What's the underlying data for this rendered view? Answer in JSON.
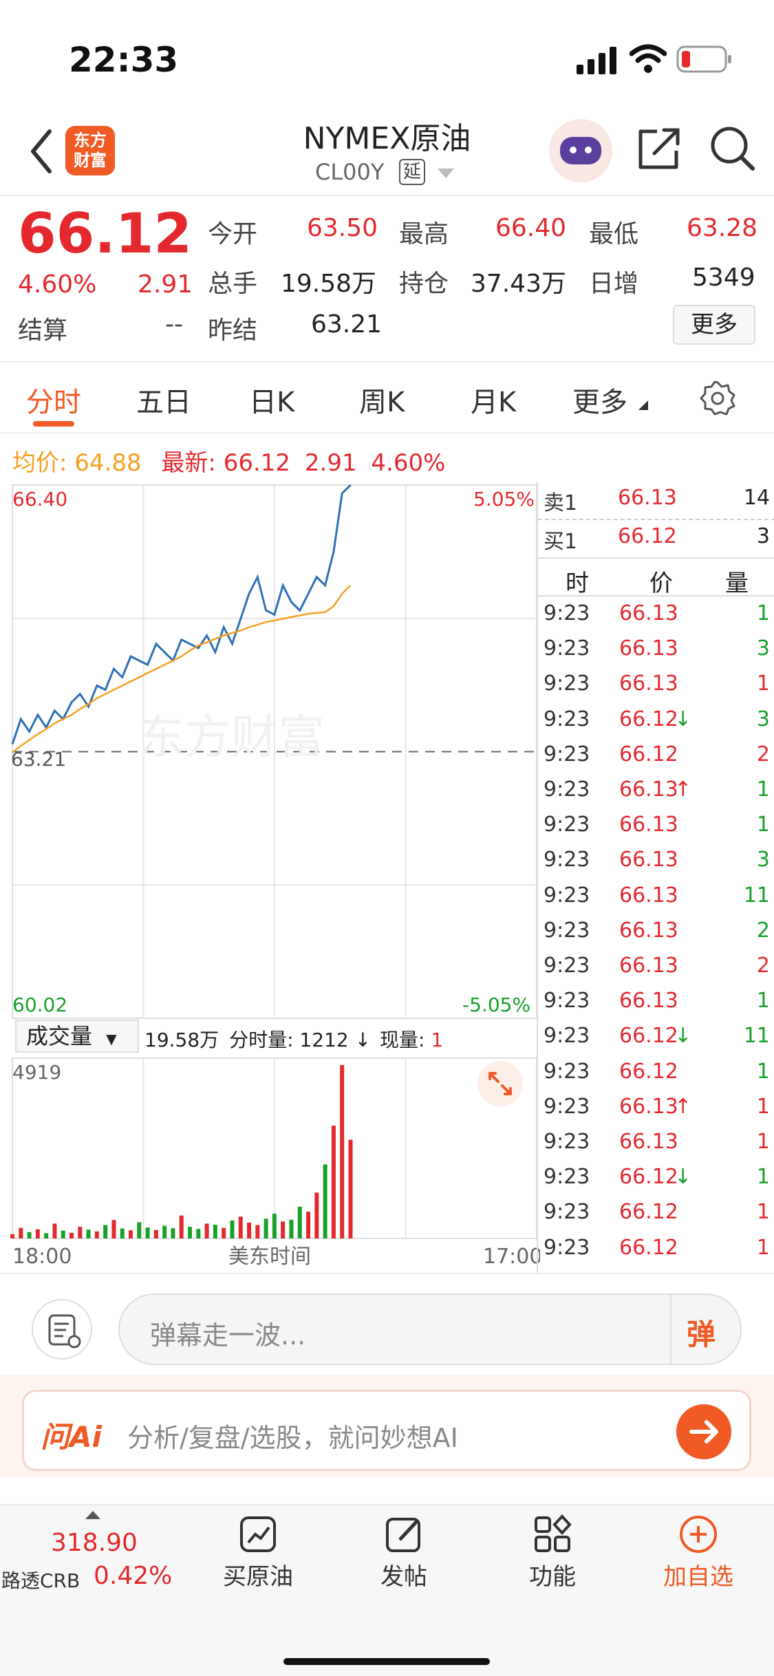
{
  "status": {
    "time": "22:33"
  },
  "header": {
    "logo_text": "东方\n财富",
    "title": "NYMEX原油",
    "code": "CL00Y",
    "delay_badge": "延"
  },
  "quote": {
    "price": "66.12",
    "change_pct": "4.60%",
    "change": "2.91",
    "settle_label": "结算",
    "settle_value": "--",
    "prev_settle_label": "昨结",
    "prev_settle_value": "63.21",
    "open_label": "今开",
    "open_value": "63.50",
    "high_label": "最高",
    "high_value": "66.40",
    "low_label": "最低",
    "low_value": "63.28",
    "volume_label": "总手",
    "volume_value": "19.58万",
    "oi_label": "持仓",
    "oi_value": "37.43万",
    "daily_inc_label": "日增",
    "daily_inc_value": "5349",
    "more_button": "更多"
  },
  "tabs": [
    "分时",
    "五日",
    "日K",
    "周K",
    "月K",
    "更多"
  ],
  "active_tab": 0,
  "avg_line": {
    "avg_label": "均价:",
    "avg_value": "64.88",
    "latest_label": "最新:",
    "latest_value": "66.12",
    "latest_change": "2.91",
    "latest_pct": "4.60%"
  },
  "chart_data": {
    "type": "line",
    "ylim": [
      60.02,
      66.4
    ],
    "y_top_label": "66.40",
    "y_bottom_label": "60.02",
    "y_mid_label": "63.21",
    "pct_top_label": "5.05%",
    "pct_bottom_label": "-5.05%",
    "x_labels": [
      "18:00",
      "美东时间",
      "17:00"
    ],
    "series": [
      {
        "values": [
          63.3,
          63.6,
          63.45,
          63.65,
          63.5,
          63.7,
          63.6,
          63.8,
          63.9,
          63.75,
          64.0,
          63.95,
          64.2,
          64.1,
          64.35,
          64.3,
          64.25,
          64.5,
          64.4,
          64.3,
          64.55,
          64.5,
          64.45,
          64.6,
          64.4,
          64.7,
          64.5,
          64.8,
          65.1,
          65.3,
          64.9,
          64.85,
          65.2,
          65.0,
          64.9,
          65.1,
          65.3,
          65.2,
          65.6,
          66.3,
          66.4
        ],
        "color": "#2d6fb9"
      },
      {
        "values": [
          63.2,
          63.28,
          63.35,
          63.42,
          63.48,
          63.55,
          63.6,
          63.65,
          63.72,
          63.78,
          63.85,
          63.9,
          63.95,
          64.0,
          64.05,
          64.1,
          64.15,
          64.2,
          64.25,
          64.3,
          64.35,
          64.42,
          64.48,
          64.52,
          64.56,
          64.6,
          64.63,
          64.66,
          64.7,
          64.73,
          64.76,
          64.78,
          64.8,
          64.82,
          64.84,
          64.86,
          64.87,
          64.88,
          64.95,
          65.1,
          65.2
        ],
        "color": "#f5a020"
      }
    ],
    "volume_max_label": "4919",
    "volume_values": [
      120,
      300,
      180,
      260,
      150,
      420,
      220,
      160,
      330,
      250,
      200,
      380,
      520,
      280,
      230,
      460,
      310,
      240,
      360,
      290,
      650,
      330,
      270,
      420,
      390,
      300,
      510,
      620,
      450,
      380,
      560,
      700,
      480,
      530,
      900,
      760,
      1300,
      2100,
      3200,
      4919,
      2800
    ]
  },
  "volume_bar": {
    "dropdown": "成交量",
    "total": "19.58万",
    "period_label": "分时量:",
    "period_value": "1212",
    "arrow": "↓",
    "now_label": "现量:",
    "now_value": "1"
  },
  "orderbook": {
    "sell_label": "卖1",
    "sell_price": "66.13",
    "sell_qty": "14",
    "buy_label": "买1",
    "buy_price": "66.12",
    "buy_qty": "3"
  },
  "trade_header": {
    "time": "时",
    "price": "价",
    "qty": "量"
  },
  "trades": [
    {
      "t": "9:23",
      "p": "66.13",
      "a": "",
      "q": "1",
      "qc": "green"
    },
    {
      "t": "9:23",
      "p": "66.13",
      "a": "",
      "q": "3",
      "qc": "green"
    },
    {
      "t": "9:23",
      "p": "66.13",
      "a": "",
      "q": "1",
      "qc": "red"
    },
    {
      "t": "9:23",
      "p": "66.12",
      "a": "↓",
      "q": "3",
      "qc": "green"
    },
    {
      "t": "9:23",
      "p": "66.12",
      "a": "",
      "q": "2",
      "qc": "red"
    },
    {
      "t": "9:23",
      "p": "66.13",
      "a": "↑",
      "q": "1",
      "qc": "green"
    },
    {
      "t": "9:23",
      "p": "66.13",
      "a": "",
      "q": "1",
      "qc": "green"
    },
    {
      "t": "9:23",
      "p": "66.13",
      "a": "",
      "q": "3",
      "qc": "green"
    },
    {
      "t": "9:23",
      "p": "66.13",
      "a": "",
      "q": "11",
      "qc": "green"
    },
    {
      "t": "9:23",
      "p": "66.13",
      "a": "",
      "q": "2",
      "qc": "green"
    },
    {
      "t": "9:23",
      "p": "66.13",
      "a": "",
      "q": "2",
      "qc": "red"
    },
    {
      "t": "9:23",
      "p": "66.13",
      "a": "",
      "q": "1",
      "qc": "green"
    },
    {
      "t": "9:23",
      "p": "66.12",
      "a": "↓",
      "q": "11",
      "qc": "green"
    },
    {
      "t": "9:23",
      "p": "66.12",
      "a": "",
      "q": "1",
      "qc": "green"
    },
    {
      "t": "9:23",
      "p": "66.13",
      "a": "↑",
      "q": "1",
      "qc": "red"
    },
    {
      "t": "9:23",
      "p": "66.13",
      "a": "",
      "q": "1",
      "qc": "red"
    },
    {
      "t": "9:23",
      "p": "66.12",
      "a": "↓",
      "q": "1",
      "qc": "green"
    },
    {
      "t": "9:23",
      "p": "66.12",
      "a": "",
      "q": "1",
      "qc": "red"
    },
    {
      "t": "9:23",
      "p": "66.12",
      "a": "",
      "q": "1",
      "qc": "red"
    }
  ],
  "danmu": {
    "placeholder": "弹幕走一波...",
    "button": "弹"
  },
  "ai": {
    "logo": "问Ai",
    "placeholder": "分析/复盘/选股，就问妙想AI"
  },
  "bottom_nav": {
    "index_value": "318.90",
    "index_name": "路透CRB",
    "index_pct": "0.42%",
    "buy": "买原油",
    "post": "发帖",
    "func": "功能",
    "add": "加自选"
  },
  "watermark": "东方财富",
  "colors": {
    "red": "#e4292e",
    "green": "#17a12b",
    "orange": "#f5a020",
    "blue": "#2d6fb9",
    "brand": "#f05a24"
  }
}
